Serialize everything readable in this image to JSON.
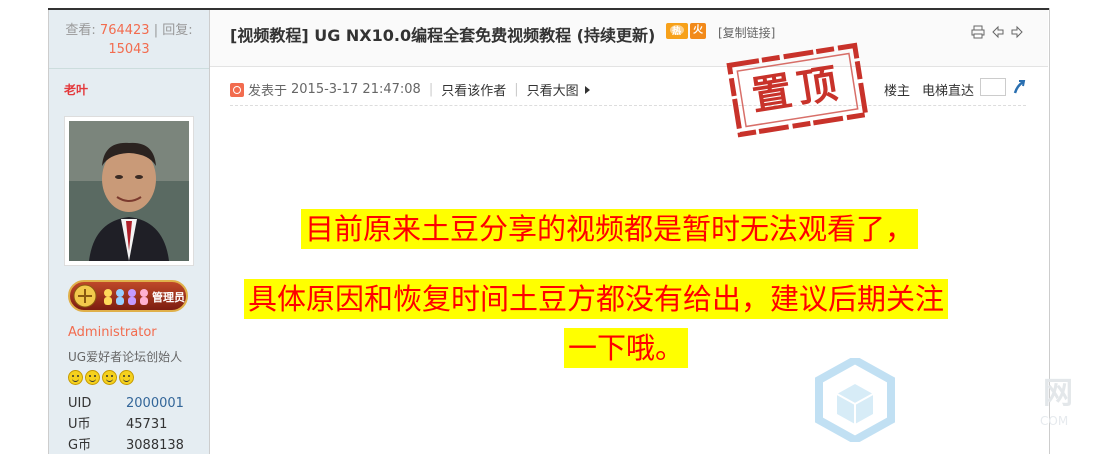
{
  "header": {
    "views_label": "查看:",
    "views": "764423",
    "replies_label": "回复:",
    "replies": "15043",
    "title": "[视频教程] UG NX10.0编程全套免费视频教程 (持续更新)",
    "badge_fire": "火",
    "copy_link": "[复制链接]",
    "icons": [
      "printer-icon",
      "prev-thread-icon",
      "next-thread-icon"
    ]
  },
  "author": {
    "name": "老叶",
    "group": "Administrator",
    "title": "UG爱好者论坛创始人",
    "badge_text": "管理员",
    "stats": [
      {
        "key": "UID",
        "value": "2000001"
      },
      {
        "key": "U币",
        "value": "45731"
      },
      {
        "key": "G币",
        "value": "3088138"
      }
    ]
  },
  "post": {
    "posted_prefix": "发表于",
    "posted_at": "2015-3-17 21:47:08",
    "only_author": "只看该作者",
    "large_image": "只看大图",
    "floor": "楼主",
    "jump_label": "电梯直达",
    "stamp": "置顶",
    "lines": [
      "目前原来土豆分享的视频都是暂时无法观看了，",
      "具体原因和恢复时间土豆方都没有给出，建议后期关注",
      "一下哦。"
    ]
  },
  "watermark": {
    "char": "网",
    "sub": "COM"
  },
  "colors": {
    "highlight_bg": "#ffff00",
    "highlight_text": "#ff0000",
    "stamp_red": "#c8322a",
    "number_orange": "#f26c4f"
  }
}
